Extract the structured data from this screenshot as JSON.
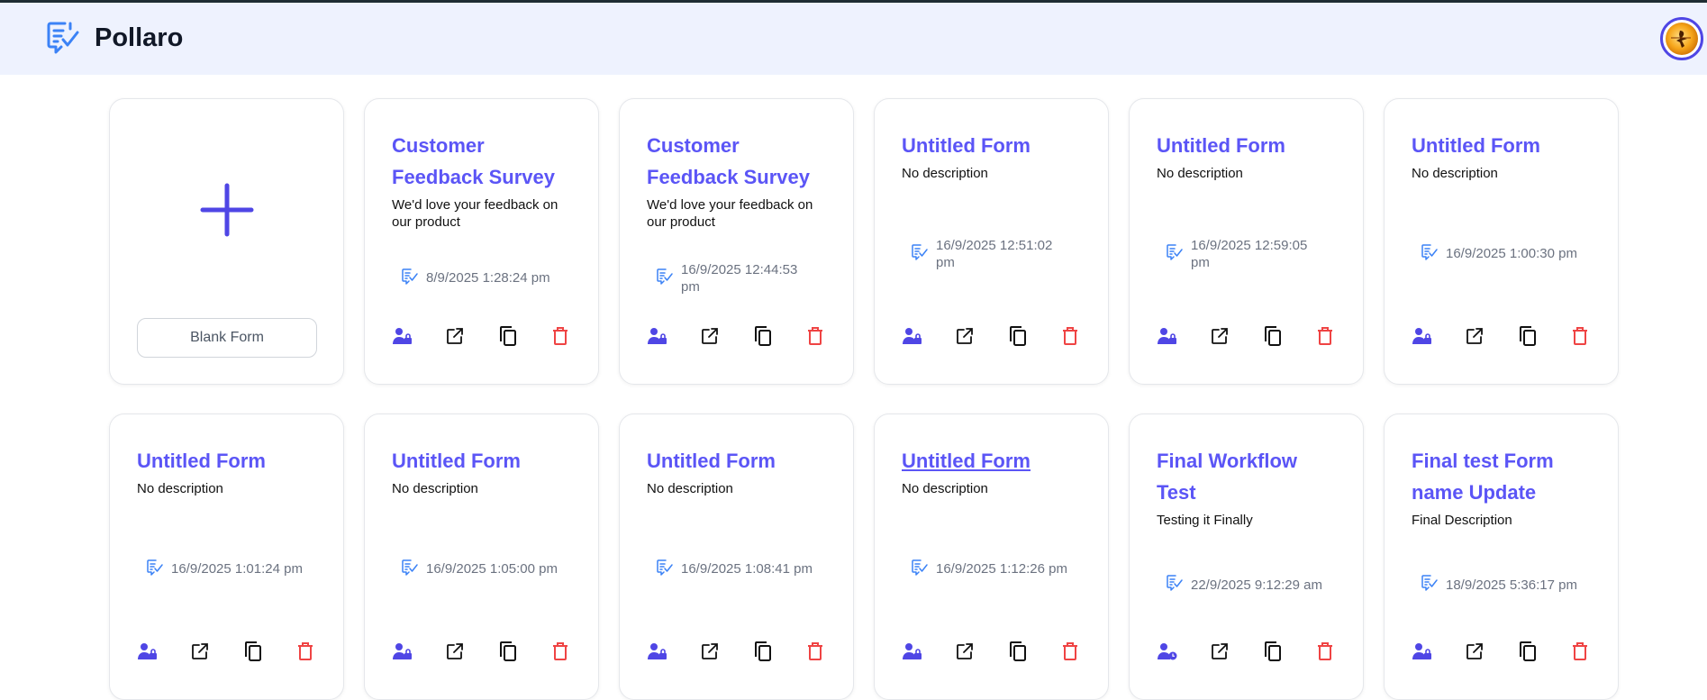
{
  "header": {
    "brand": "Pollaro"
  },
  "blank_card": {
    "label": "Blank Form"
  },
  "colors": {
    "accent": "#5b55f6",
    "icon_purple": "#4f46e5",
    "danger": "#ef4444",
    "meta": "#6b7280"
  },
  "forms": [
    {
      "title": "Customer Feedback Survey",
      "description": "We'd love your feedback on our product",
      "date": "8/9/2025",
      "time": "1:28:24 pm",
      "access_icon": "user-lock-icon"
    },
    {
      "title": "Customer Feedback Survey",
      "description": "We'd love your feedback on our product",
      "date": "16/9/2025",
      "time": "12:44:53 pm",
      "access_icon": "user-lock-icon"
    },
    {
      "title": "Untitled Form",
      "description": "No description",
      "date": "16/9/2025",
      "time": "12:51:02 pm",
      "access_icon": "user-lock-icon"
    },
    {
      "title": "Untitled Form",
      "description": "No description",
      "date": "16/9/2025",
      "time": "12:59:05 pm",
      "access_icon": "user-lock-icon"
    },
    {
      "title": "Untitled Form",
      "description": "No description",
      "date": "16/9/2025",
      "time": "1:00:30 pm",
      "access_icon": "user-lock-icon"
    },
    {
      "title": "Untitled Form",
      "description": "No description",
      "date": "16/9/2025",
      "time": "1:01:24 pm",
      "access_icon": "user-lock-icon"
    },
    {
      "title": "Untitled Form",
      "description": "No description",
      "date": "16/9/2025",
      "time": "1:05:00 pm",
      "access_icon": "user-lock-icon"
    },
    {
      "title": "Untitled Form",
      "description": "No description",
      "date": "16/9/2025",
      "time": "1:08:41 pm",
      "access_icon": "user-lock-icon"
    },
    {
      "title": "Untitled Form",
      "description": "No description",
      "date": "16/9/2025",
      "time": "1:12:26 pm",
      "access_icon": "user-lock-icon"
    },
    {
      "title": "Final Workflow Test",
      "description": "Testing it Finally",
      "date": "22/9/2025",
      "time": "9:12:29 am",
      "access_icon": "user-clock-icon"
    },
    {
      "title": "Final test Form name Update",
      "description": "Final Description",
      "date": "18/9/2025",
      "time": "5:36:17 pm",
      "access_icon": "user-lock-icon"
    }
  ]
}
